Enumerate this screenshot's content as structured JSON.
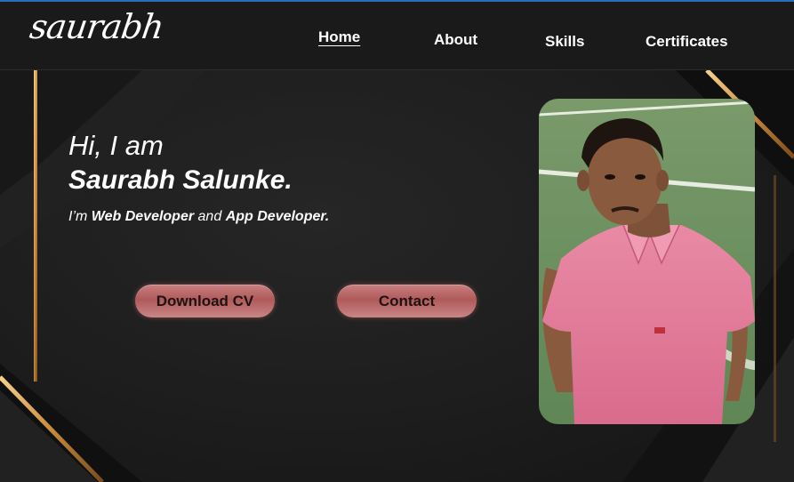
{
  "navbar": {
    "logo": "saurabh",
    "items": [
      {
        "label": "Home",
        "active": true
      },
      {
        "label": "About",
        "active": false
      },
      {
        "label": "Skills",
        "active": false
      },
      {
        "label": "Certificates",
        "active": false
      }
    ]
  },
  "hero": {
    "greeting": "Hi, I am",
    "name": "Saurabh Salunke.",
    "roles_prefix": "I’m",
    "role_1": "Web Developer",
    "roles_and": "and",
    "role_2": "App Developer."
  },
  "buttons": {
    "download_cv": "Download CV",
    "contact": "Contact"
  },
  "colors": {
    "background": "#1b1b1b",
    "gold_accent": "#d9a35a",
    "button_gradient": "#b05a5a",
    "top_accent": "#2b6fb8"
  },
  "photo": {
    "icon": "profile-photo"
  }
}
